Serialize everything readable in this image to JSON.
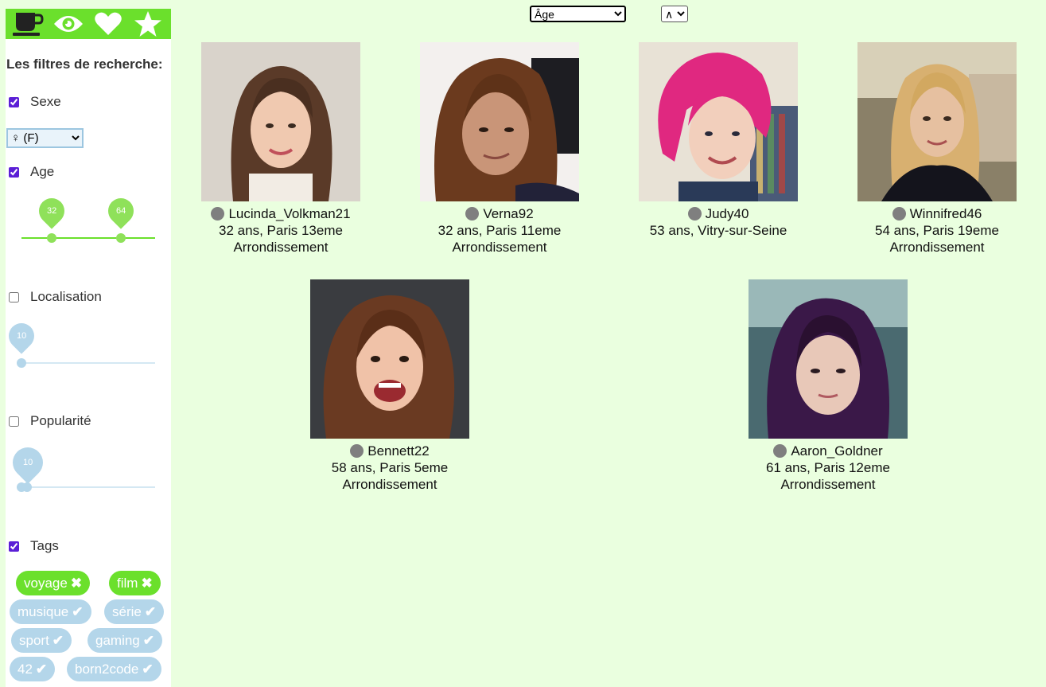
{
  "sidebar": {
    "icons": [
      "cup-icon",
      "eye-icon",
      "heart-icon",
      "star-icon"
    ],
    "filters_title": "Les filtres de recherche:",
    "sexe": {
      "label": "Sexe",
      "checked": true,
      "selected": "♀ (F)"
    },
    "age": {
      "label": "Age",
      "checked": true,
      "min": "32",
      "max": "64"
    },
    "localisation": {
      "label": "Localisation",
      "checked": false,
      "value": "10"
    },
    "popularite": {
      "label": "Popularité",
      "checked": false,
      "value": "10"
    },
    "tags": {
      "label": "Tags",
      "checked": true,
      "items": [
        {
          "label": "voyage",
          "active": true
        },
        {
          "label": "film",
          "active": true
        },
        {
          "label": "musique",
          "active": false
        },
        {
          "label": "série",
          "active": false
        },
        {
          "label": "sport",
          "active": false
        },
        {
          "label": "gaming",
          "active": false
        },
        {
          "label": "42",
          "active": false
        },
        {
          "label": "born2code",
          "active": false
        }
      ]
    }
  },
  "sort": {
    "selected": "Âge",
    "order": "∧"
  },
  "colors": {
    "accent_green": "#6be02c",
    "inactive_blue": "#b4d6ea",
    "background": "#eaffdf",
    "status_gray": "#7f7f7f"
  },
  "profiles": [
    {
      "name": "Lucinda_Volkman21",
      "info": "32 ans, Paris 13eme Arrondissement"
    },
    {
      "name": "Verna92",
      "info": "32 ans, Paris 11eme Arrondissement"
    },
    {
      "name": "Judy40",
      "info": "53 ans, Vitry-sur-Seine"
    },
    {
      "name": "Winnifred46",
      "info": "54 ans, Paris 19eme Arrondissement"
    },
    {
      "name": "Bennett22",
      "info": "58 ans, Paris 5eme Arrondissement"
    },
    {
      "name": "Aaron_Goldner",
      "info": "61 ans, Paris 12eme Arrondissement"
    }
  ]
}
